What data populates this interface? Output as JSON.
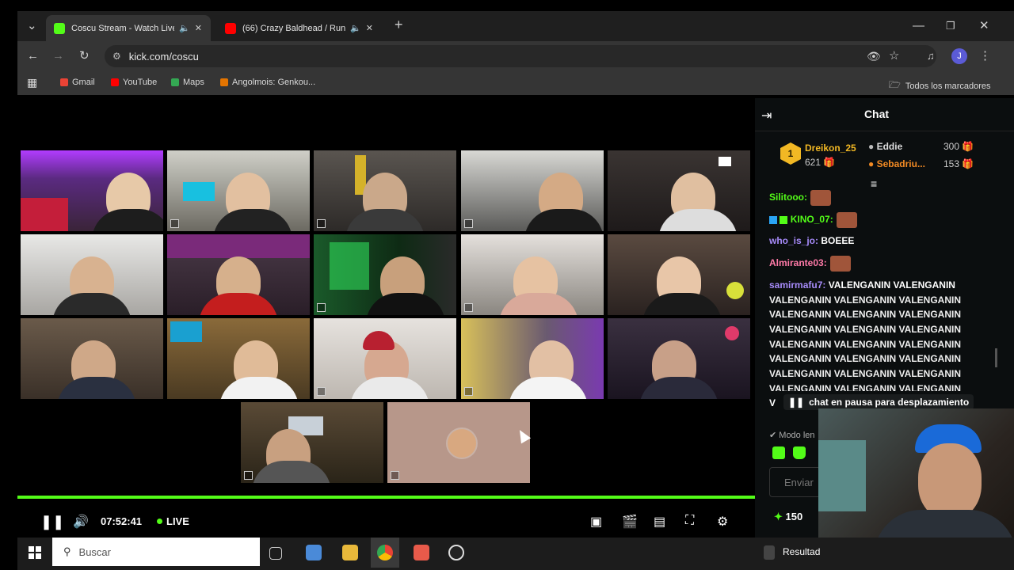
{
  "browser": {
    "tabs": [
      {
        "title": "Coscu Stream - Watch Live",
        "favicon_color": "#53fc18",
        "active": true
      },
      {
        "title": "(66) Crazy Baldhead / Runn",
        "favicon_color": "#ff0000",
        "active": false
      }
    ],
    "new_tab": "+",
    "url": "kick.com/coscu",
    "bookmarks": [
      {
        "label": "Gmail",
        "color": "#ea4335"
      },
      {
        "label": "YouTube",
        "color": "#ff0000"
      },
      {
        "label": "Maps",
        "color": "#34a853"
      },
      {
        "label": "Angolmois: Genkou...",
        "color": "#e37400"
      }
    ],
    "all_bookmarks": "Todos los marcadores",
    "profile_initial": "J"
  },
  "player": {
    "time": "07:52:41",
    "live_label": "LIVE",
    "live_color": "#53fc18",
    "progress": 1.0
  },
  "chat": {
    "title": "Chat",
    "leaderboard": {
      "rank": "1",
      "first": {
        "name": "Dreikon_25",
        "amount": "621"
      },
      "others": [
        {
          "name": "Eddie",
          "amount": "300"
        },
        {
          "name": "Sebadriu...",
          "amount": "153"
        }
      ]
    },
    "messages": [
      {
        "user": "Silitooo:",
        "color": "#53fc18",
        "text": ""
      },
      {
        "user": "KINO_07:",
        "color": "#53fc18",
        "text": ""
      },
      {
        "user": "who_is_jo:",
        "color": "#a78bfa",
        "text": "BOEEE"
      },
      {
        "user": "Almirante03:",
        "color": "#ff7aa8",
        "text": ""
      },
      {
        "user": "samirmafu7:",
        "color": "#a78bfa",
        "text": "VALENGANIN VALENGANIN"
      }
    ],
    "spam_lines": [
      "VALENGANIN VALENGANIN VALENGANIN",
      "VALENGANIN VALENGANIN VALENGANIN",
      "VALENGANIN VALENGANIN VALENGANIN",
      "VALENGANIN VALENGANIN VALENGANIN",
      "VALENGANIN VALENGANIN VALENGANIN",
      "VALENGANIN VALENGANIN VALENGANIN",
      "VALENGANIN VALENGANIN VALENGANIN"
    ],
    "paused_notice": "chat en pausa para desplazamiento",
    "slow_mode": "Modo len",
    "send_placeholder": "Enviar",
    "points": "150",
    "partial_letter": "V"
  },
  "taskbar": {
    "search_placeholder": "Buscar",
    "results_label": "Resultad"
  }
}
